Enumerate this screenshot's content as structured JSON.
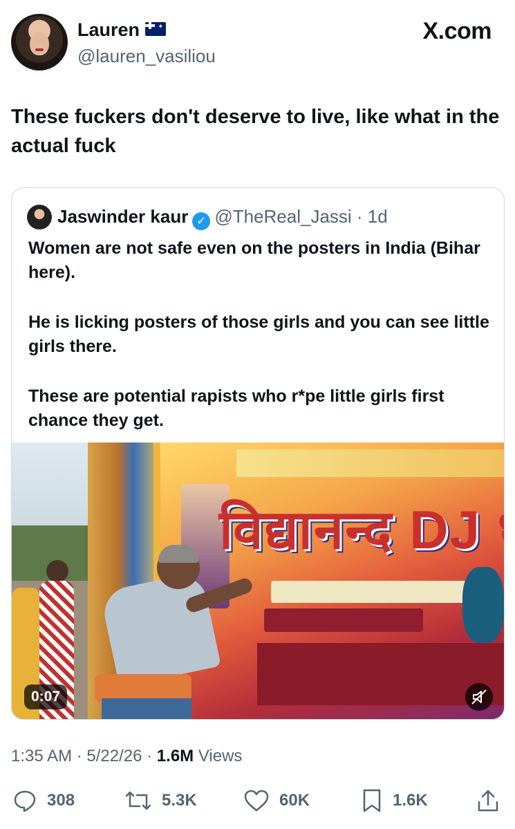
{
  "author": {
    "name": "Lauren",
    "flag_icon": "australia-flag-icon",
    "handle": "@lauren_vasiliou"
  },
  "site_label": "X.com",
  "tweet": {
    "text": "These fuckers don't deserve to live, like what in the actual fuck"
  },
  "quoted": {
    "name": "Jaswinder kaur",
    "verified_icon": "verified-badge-icon",
    "handle_time": "@TheReal_Jassi · 1d",
    "paragraphs": [
      "Women are not safe even on the posters in India (Bihar here).",
      "He is licking posters of those girls and you can see little girls there.",
      "These are potential rapists who r*pe little girls first chance they get."
    ],
    "video": {
      "duration": "0:07",
      "mute_icon": "muted-speaker-icon",
      "banner_text": "विद्यानन्द DJ धमा"
    }
  },
  "meta": {
    "time_date": "1:35 AM · 5/22/26 · ",
    "views_count": "1.6M",
    "views_label": " Views"
  },
  "actions": {
    "replies": "308",
    "reposts": "5.3K",
    "likes": "60K",
    "bookmarks": "1.6K"
  },
  "colors": {
    "text": "#0f1419",
    "muted": "#536471",
    "verified": "#1d9bf0",
    "border": "#cfd9de"
  }
}
